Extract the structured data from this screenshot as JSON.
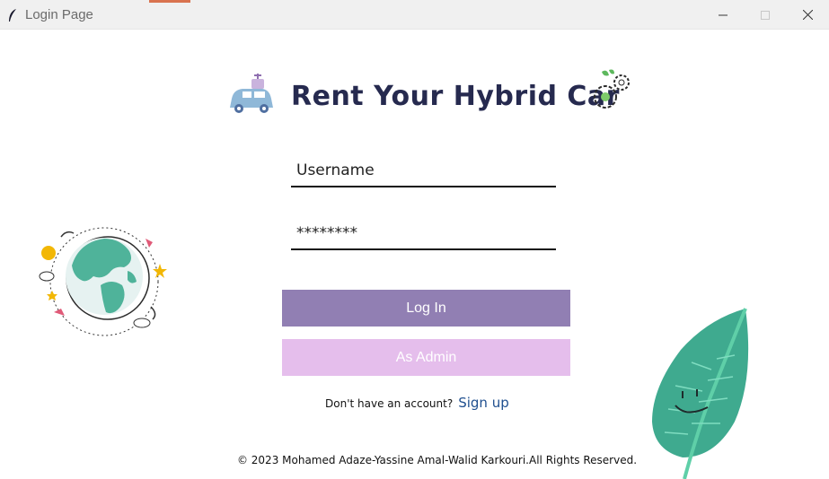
{
  "window": {
    "title": "Login Page",
    "controls": {
      "minimize_icon": "minimize-icon",
      "maximize_icon": "maximize-icon",
      "close_icon": "close-icon"
    }
  },
  "brand": {
    "title": "Rent Your Hybrid Car",
    "left_icon": "electric-car-icon",
    "right_icon": "eco-gears-icon"
  },
  "form": {
    "username_placeholder": "Username",
    "password_value": "********",
    "login_label": "Log In",
    "admin_label": "As Admin",
    "signup_prompt": "Don't have an account?",
    "signup_link": "Sign up"
  },
  "footer": {
    "text": "© 2023  Mohamed Adaze-Yassine Amal-Walid Karkouri.All Rights Reserved."
  },
  "illustrations": {
    "globe": "earth-globe-illustration",
    "leaf": "smiling-leaf-illustration"
  },
  "colors": {
    "login_button": "#917fb3",
    "admin_button": "#e5beec",
    "title_text": "#262a4f",
    "link": "#1f4f8f"
  }
}
